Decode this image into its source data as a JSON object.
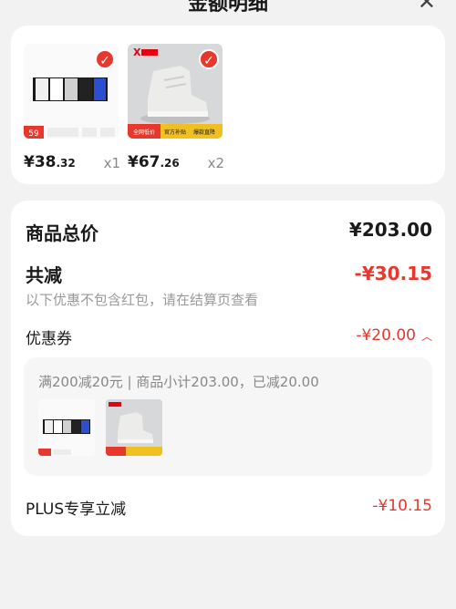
{
  "header": {
    "title": "金额明细",
    "close_icon": "close-icon"
  },
  "products": [
    {
      "price_int": "¥38",
      "price_dec": ".32",
      "qty": "x1",
      "badge": "59"
    },
    {
      "price_int": "¥67",
      "price_dec": ".26",
      "qty": "x2",
      "tags": [
        "全网低价",
        "官方补贴",
        "爆款直降"
      ]
    }
  ],
  "summary": {
    "total_label": "商品总价",
    "total_value": "¥203.00",
    "discount_label": "共减",
    "discount_value": "-¥30.15",
    "discount_note": "以下优惠不包含红包，请在结算页查看",
    "coupon_label": "优惠券",
    "coupon_value": "-¥20.00",
    "coupon_desc": "满200减20元 | 商品小计203.00，已减20.00",
    "plus_label": "PLUS专享立减",
    "plus_value": "-¥10.15"
  },
  "colors": {
    "accent": "#e8372c",
    "brand": "#e60012"
  }
}
